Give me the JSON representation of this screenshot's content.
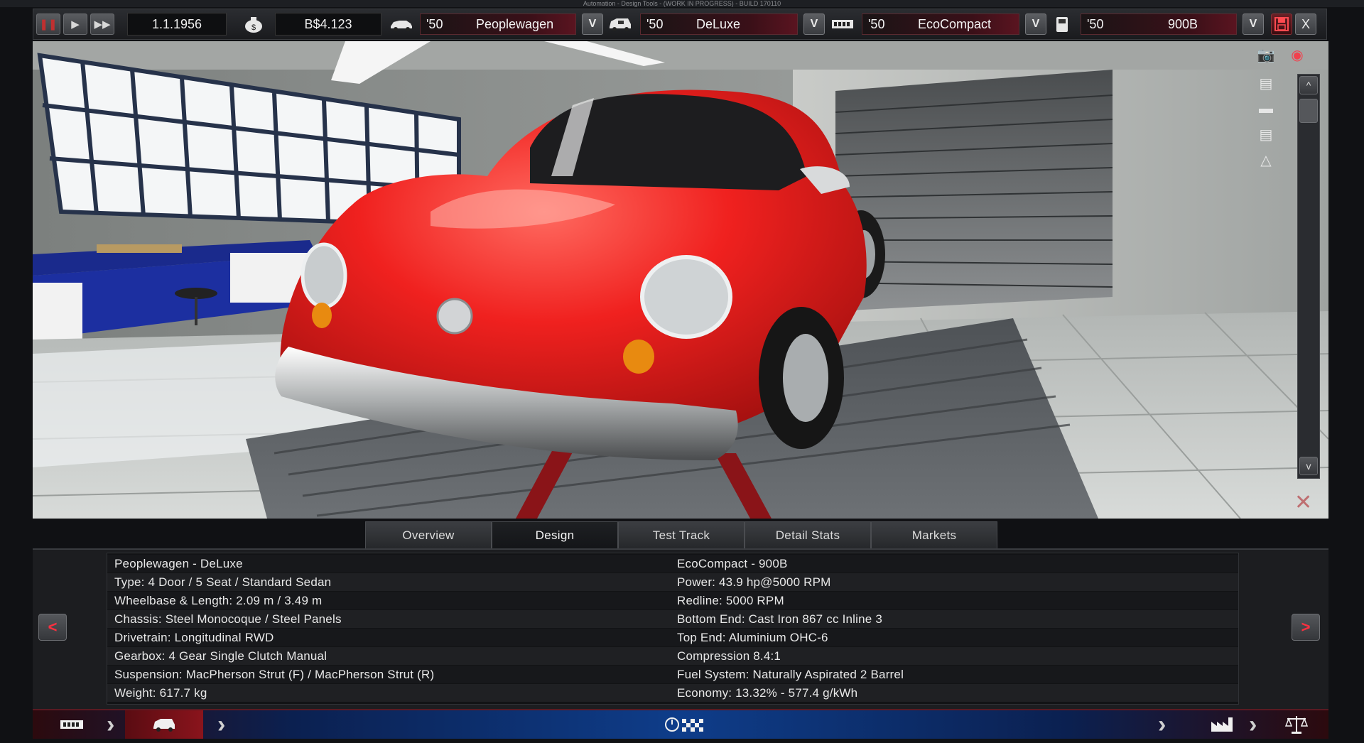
{
  "window": {
    "title": "Automation - Design Tools - (WORK IN PROGRESS) - BUILD 170110"
  },
  "toolbar": {
    "date": "1.1.1956",
    "money": "B$4.123",
    "model": {
      "year": "'50",
      "name": "Peoplewagen"
    },
    "trim": {
      "year": "'50",
      "name": "DeLuxe"
    },
    "engine": {
      "year": "'50",
      "name": "EcoCompact"
    },
    "variant": {
      "year": "'50",
      "name": "900B"
    },
    "v_label": "V",
    "close_label": "X"
  },
  "viewport": {
    "scroll_up": "^",
    "scroll_down": "v",
    "car_color": "#f0211f"
  },
  "tabs": [
    "Overview",
    "Design",
    "Test Track",
    "Detail Stats",
    "Markets"
  ],
  "active_tab": "Design",
  "info": {
    "left": [
      "Peoplewagen - DeLuxe",
      "Type: 4 Door / 5 Seat / Standard Sedan",
      "Wheelbase & Length: 2.09 m / 3.49 m",
      "Chassis: Steel Monocoque / Steel Panels",
      "Drivetrain: Longitudinal RWD",
      "Gearbox: 4 Gear Single Clutch Manual",
      "Suspension: MacPherson Strut (F) / MacPherson Strut (R)",
      "Weight: 617.7 kg"
    ],
    "right": [
      "EcoCompact - 900B",
      "Power: 43.9 hp@5000 RPM",
      "Redline: 5000 RPM",
      "Bottom End: Cast Iron 867 cc Inline 3",
      "Top End: Aluminium OHC-6",
      "Compression 8.4:1",
      "Fuel System: Naturally Aspirated 2 Barrel",
      "Economy: 13.32% - 577.4 g/kWh"
    ],
    "prev_label": "<",
    "next_label": ">"
  },
  "icons": {
    "pause": "pause-icon",
    "play": "play-icon",
    "fast_forward": "fast-forward-icon",
    "money": "money-bag-icon",
    "car": "car-icon",
    "trim": "trim-icon",
    "engine": "engine-icon",
    "variant": "fuel-icon",
    "save": "save-icon"
  }
}
